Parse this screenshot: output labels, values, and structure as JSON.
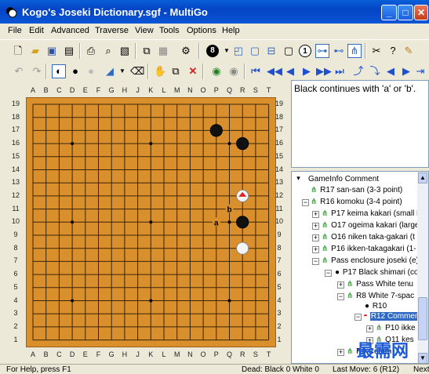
{
  "window": {
    "title": "Kogo's Joseki Dictionary.sgf - MultiGo"
  },
  "menu": [
    "File",
    "Edit",
    "Advanced",
    "Traverse",
    "View",
    "Tools",
    "Options",
    "Help"
  ],
  "board": {
    "size": 19,
    "columns": [
      "A",
      "B",
      "C",
      "D",
      "E",
      "F",
      "G",
      "H",
      "J",
      "K",
      "L",
      "M",
      "N",
      "O",
      "P",
      "Q",
      "R",
      "S",
      "T"
    ],
    "rows": [
      "19",
      "18",
      "17",
      "16",
      "15",
      "14",
      "13",
      "12",
      "11",
      "10",
      "9",
      "8",
      "7",
      "6",
      "5",
      "4",
      "3",
      "2",
      "1"
    ],
    "stones": [
      {
        "color": "black",
        "point": "P17"
      },
      {
        "color": "black",
        "point": "R16"
      },
      {
        "color": "white",
        "point": "R12",
        "marked": true
      },
      {
        "color": "black",
        "point": "R10"
      },
      {
        "color": "white",
        "point": "R8"
      }
    ],
    "labels": [
      {
        "text": "a",
        "point": "P10"
      },
      {
        "text": "b",
        "point": "Q11"
      }
    ]
  },
  "comment": {
    "text": "Black continues with 'a' or 'b'."
  },
  "tree": {
    "header": "GameInfo Comment",
    "nodes": [
      {
        "label": "R17 san-san (3-3 point)"
      },
      {
        "label": "R16 komoku (3-4 point)"
      },
      {
        "label": "P17 keima kakari (small k"
      },
      {
        "label": "O17 ogeima kakari (large"
      },
      {
        "label": "O16 niken taka-gakari (t"
      },
      {
        "label": "P16 ikken-takagakari (1-"
      },
      {
        "label": "Pass enclosure joseki (e)"
      },
      {
        "label": "P17 Black shimari (co"
      },
      {
        "label": "Pass White tenu"
      },
      {
        "label": "R8 White 7-spac"
      },
      {
        "label": "R10"
      },
      {
        "label": "R12 Comment"
      },
      {
        "label": "P10 ikke"
      },
      {
        "label": "Q11 kes"
      },
      {
        "label": "R9 Comm"
      }
    ]
  },
  "status": {
    "help": "For Help, press F1",
    "dead": "Dead: Black 0 White 0",
    "last_move": "Last Move: 6 (R12)",
    "next": "Next"
  },
  "toolbar": {
    "number_badge": "8",
    "number_badge2": "1"
  },
  "watermark": "最需网",
  "colors": {
    "board": "#d98f2c",
    "titlebar": "#0344c4",
    "selection": "#316ac5"
  }
}
